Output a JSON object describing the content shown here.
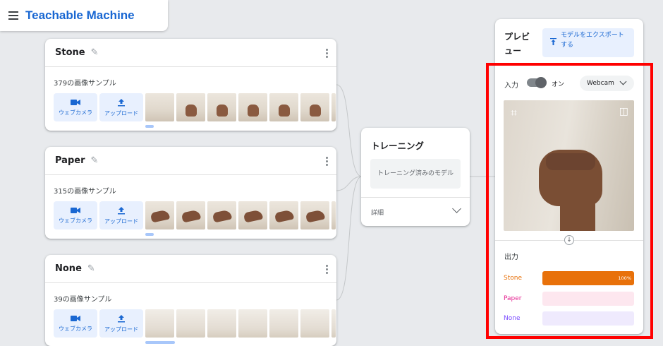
{
  "header": {
    "title": "Teachable Machine"
  },
  "classes": [
    {
      "name": "Stone",
      "samples": "379の画像サンプル",
      "webcam_label": "ウェブカメラ",
      "upload_label": "アップロード"
    },
    {
      "name": "Paper",
      "samples": "315の画像サンプル",
      "webcam_label": "ウェブカメラ",
      "upload_label": "アップロード"
    },
    {
      "name": "None",
      "samples": "39の画像サンプル",
      "webcam_label": "ウェブカメラ",
      "upload_label": "アップロード"
    }
  ],
  "training": {
    "title": "トレーニング",
    "status_button": "トレーニング済みのモデル",
    "advanced_label": "詳細"
  },
  "preview": {
    "title": "プレビュー",
    "export_button": "モデルをエクスポートする",
    "input_label": "入力",
    "toggle_label": "オン",
    "toggle_on": true,
    "source_select": "Webcam",
    "output_title": "出力",
    "outputs": [
      {
        "label": "Stone",
        "confidence": 1.0,
        "percent_text": "100%",
        "color": "#e8710a",
        "track": "#fce8d6"
      },
      {
        "label": "Paper",
        "confidence": 0.0,
        "percent_text": "",
        "color": "#e52592",
        "track": "#fde7ef"
      },
      {
        "label": "None",
        "confidence": 0.0,
        "percent_text": "",
        "color": "#7c4dff",
        "track": "#efeafd"
      }
    ]
  },
  "colors": {
    "accent": "#1967d2",
    "highlight": "#ff0000"
  },
  "icons": {
    "menu": "hamburger-icon",
    "edit": "pencil-icon",
    "more": "more-vert-icon",
    "webcam": "videocam-icon",
    "upload": "upload-icon",
    "crop": "crop-icon",
    "flip": "flip-icon"
  }
}
